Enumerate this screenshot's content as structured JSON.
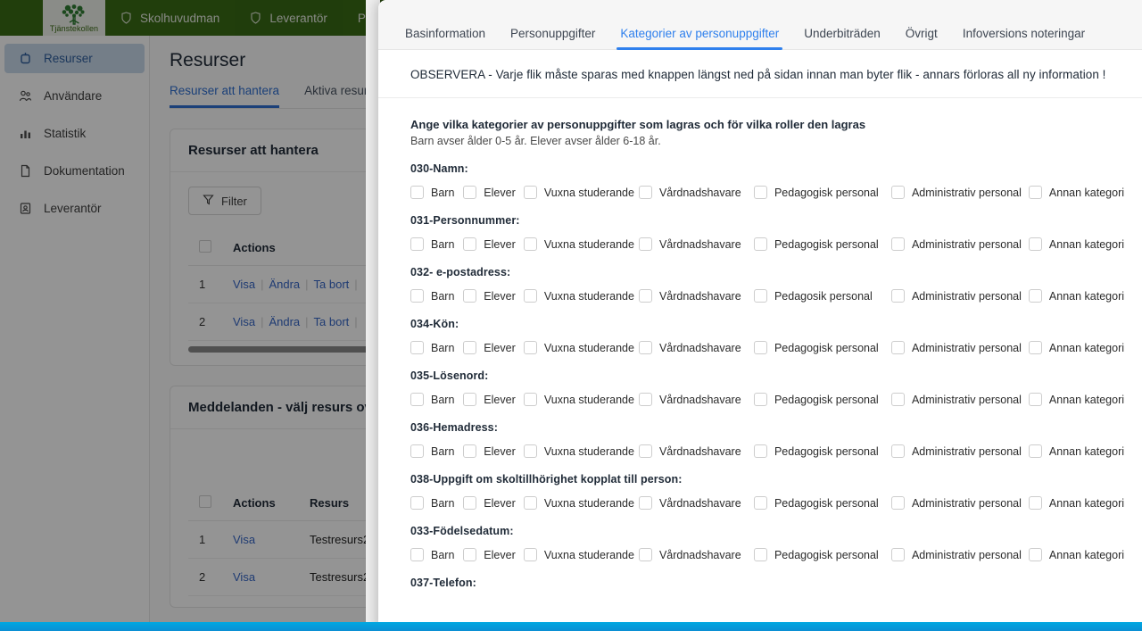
{
  "topnav": {
    "logo_caption": "Tjänstekollen",
    "items": [
      {
        "label": "Skolhuvudman",
        "icon": "shield-icon"
      },
      {
        "label": "Leverantör",
        "icon": "shield-icon"
      },
      {
        "label": "P",
        "icon": "shield-icon"
      }
    ]
  },
  "sidebar": {
    "items": [
      {
        "label": "Resurser",
        "icon": "resource-icon",
        "active": true
      },
      {
        "label": "Användare",
        "icon": "users-icon",
        "active": false
      },
      {
        "label": "Statistik",
        "icon": "chart-icon",
        "active": false
      },
      {
        "label": "Dokumentation",
        "icon": "document-icon",
        "active": false
      },
      {
        "label": "Leverantör",
        "icon": "vendor-icon",
        "active": false
      }
    ]
  },
  "content": {
    "page_title": "Resurser",
    "tabs": [
      {
        "label": "Resurser att hantera",
        "selected": true
      },
      {
        "label": "Aktiva resurser",
        "selected": false
      }
    ],
    "card1": {
      "title": "Resurser att hantera",
      "filter_label": "Filter",
      "columns": [
        "Actions"
      ],
      "rows": [
        {
          "num": "1",
          "actions": [
            "Visa",
            "Ändra",
            "Ta bort"
          ]
        },
        {
          "num": "2",
          "actions": [
            "Visa",
            "Ändra",
            "Ta bort"
          ]
        }
      ]
    },
    "card2": {
      "title": "Meddelanden - välj resurs ovan sa",
      "columns": [
        "Actions",
        "Resurs"
      ],
      "rows": [
        {
          "num": "1",
          "action": "Visa",
          "resurs": "Testresurs2"
        },
        {
          "num": "2",
          "action": "Visa",
          "resurs": "Testresurs2"
        }
      ]
    }
  },
  "modal": {
    "tabs": [
      {
        "label": "Basinformation",
        "selected": false
      },
      {
        "label": "Personuppgifter",
        "selected": false
      },
      {
        "label": "Kategorier av personuppgifter",
        "selected": true
      },
      {
        "label": "Underbiträden",
        "selected": false
      },
      {
        "label": "Övrigt",
        "selected": false
      },
      {
        "label": "Infoversions noteringar",
        "selected": false
      }
    ],
    "notice": "OBSERVERA - Varje flik måste sparas med knappen längst ned på sidan innan man byter flik - annars förloras all ny information !",
    "form_lead": "Ange vilka kategorier av personuppgifter som lagras och för vilka roller den lagras",
    "form_sub": "Barn avser ålder 0-5 år. Elever avser ålder 6-18 år.",
    "fields": [
      {
        "label": "030-Namn:",
        "options": [
          "Barn",
          "Elever",
          "Vuxna studerande",
          "Vårdnadshavare",
          "Pedagogisk personal",
          "Administrativ personal",
          "Annan kategori"
        ]
      },
      {
        "label": "031-Personnummer:",
        "options": [
          "Barn",
          "Elever",
          "Vuxna studerande",
          "Vårdnadshavare",
          "Pedagogisk personal",
          "Administrativ personal",
          "Annan kategori"
        ]
      },
      {
        "label": "032- e-postadress:",
        "options": [
          "Barn",
          "Elever",
          "Vuxna studerande",
          "Vårdnadshavare",
          "Pedagosik personal",
          "Administrativ personal",
          "Annan kategori"
        ]
      },
      {
        "label": "034-Kön:",
        "options": [
          "Barn",
          "Elever",
          "Vuxna studerande",
          "Vårdnadshavare",
          "Pedagogisk personal",
          "Administrativ personal",
          "Annan kategori"
        ]
      },
      {
        "label": "035-Lösenord:",
        "options": [
          "Barn",
          "Elever",
          "Vuxna studerande",
          "Vårdnadshavare",
          "Pedagogisk personal",
          "Administrativ personal",
          "Annan kategori"
        ]
      },
      {
        "label": "036-Hemadress:",
        "options": [
          "Barn",
          "Elever",
          "Vuxna studerande",
          "Vårdnadshavare",
          "Pedagogisk personal",
          "Administrativ personal",
          "Annan kategori"
        ]
      },
      {
        "label": "038-Uppgift om skoltillhörighet kopplat till person:",
        "options": [
          "Barn",
          "Elever",
          "Vuxna studerande",
          "Vårdnadshavare",
          "Pedagogisk personal",
          "Administrativ personal",
          "Annan kategori"
        ]
      },
      {
        "label": "033-Födelsedatum:",
        "options": [
          "Barn",
          "Elever",
          "Vuxna studerande",
          "Vårdnadshavare",
          "Pedagogisk personal",
          "Administrativ personal",
          "Annan kategori"
        ]
      },
      {
        "label": "037-Telefon:",
        "options": []
      }
    ]
  },
  "colors": {
    "nav_green": "#3a6b16",
    "accent_blue": "#2f80ed",
    "link_blue": "#3667c7",
    "bottom_bar": "#00a7e1"
  }
}
